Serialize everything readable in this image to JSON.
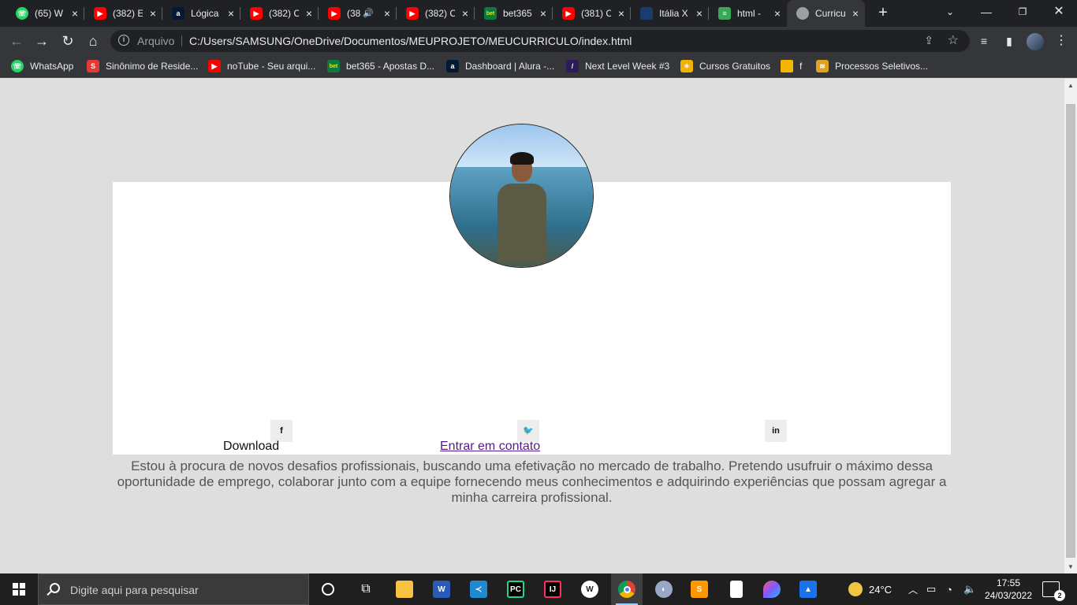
{
  "browser": {
    "tabs": [
      {
        "title": "(65) W",
        "icon": "whatsapp-icon",
        "x_label": "×"
      },
      {
        "title": "(382) E",
        "icon": "youtube-icon",
        "x_label": "×"
      },
      {
        "title": "Lógica",
        "icon": "alura-icon",
        "x_label": "×"
      },
      {
        "title": "(382) C",
        "icon": "youtube-icon",
        "x_label": "×"
      },
      {
        "title": "(38",
        "icon": "youtube-icon",
        "x_label": "×"
      },
      {
        "title": "(382) C",
        "icon": "youtube-icon",
        "x_label": "×"
      },
      {
        "title": "bet365",
        "icon": "bet365-icon",
        "x_label": "×"
      },
      {
        "title": "(381) C",
        "icon": "youtube-icon",
        "x_label": "×"
      },
      {
        "title": "Itália X",
        "icon": "italia-icon",
        "x_label": "×"
      },
      {
        "title": "html -",
        "icon": "html-icon",
        "x_label": "×"
      },
      {
        "title": "Curricu",
        "icon": "globe-icon",
        "x_label": "×"
      }
    ],
    "address": {
      "scheme": "Arquivo",
      "url": "C:/Users/SAMSUNG/OneDrive/Documentos/MEUPROJETO/MEUCURRICULO/index.html"
    },
    "bookmarks": [
      {
        "label": "WhatsApp",
        "icon": "whatsapp-icon"
      },
      {
        "label": "Sinônimo de Reside...",
        "icon": "sinonimo-icon"
      },
      {
        "label": "noTube - Seu arqui...",
        "icon": "youtube-icon"
      },
      {
        "label": "bet365 - Apostas D...",
        "icon": "bet365-icon"
      },
      {
        "label": "Dashboard | Alura -...",
        "icon": "alura-icon"
      },
      {
        "label": "Next Level Week #3",
        "icon": "nlw-icon"
      },
      {
        "label": "Cursos Gratuitos",
        "icon": "cursos-icon"
      },
      {
        "label": "f",
        "icon": "folder-icon"
      },
      {
        "label": "Processos Seletivos...",
        "icon": "processos-icon"
      }
    ]
  },
  "page": {
    "social": [
      {
        "label": "f",
        "icon": "facebook-icon"
      },
      {
        "label": "t",
        "icon": "twitter-icon"
      },
      {
        "label": "in",
        "icon": "linkedin-icon"
      }
    ],
    "bio": "Estou à procura de novos desafios profissionais, buscando uma efetivação no mercado de trabalho. Pretendo usufruir o máximo dessa oportunidade de emprego, colaborar junto com a equipe fornecendo meus conhecimentos e adquirindo experiências que possam agregar a minha carreira profissional.",
    "download_label": "Download",
    "contact_label": "Entrar em contato"
  },
  "taskbar": {
    "search_placeholder": "Digite aqui para pesquisar",
    "weather": "24°C",
    "time": "17:55",
    "date": "24/03/2022",
    "notification_count": "2"
  },
  "colors": {
    "page_bg": "#dedede",
    "card_bg": "#ffffff",
    "link_visited": "#551a8b",
    "chrome_dark": "#202124"
  }
}
